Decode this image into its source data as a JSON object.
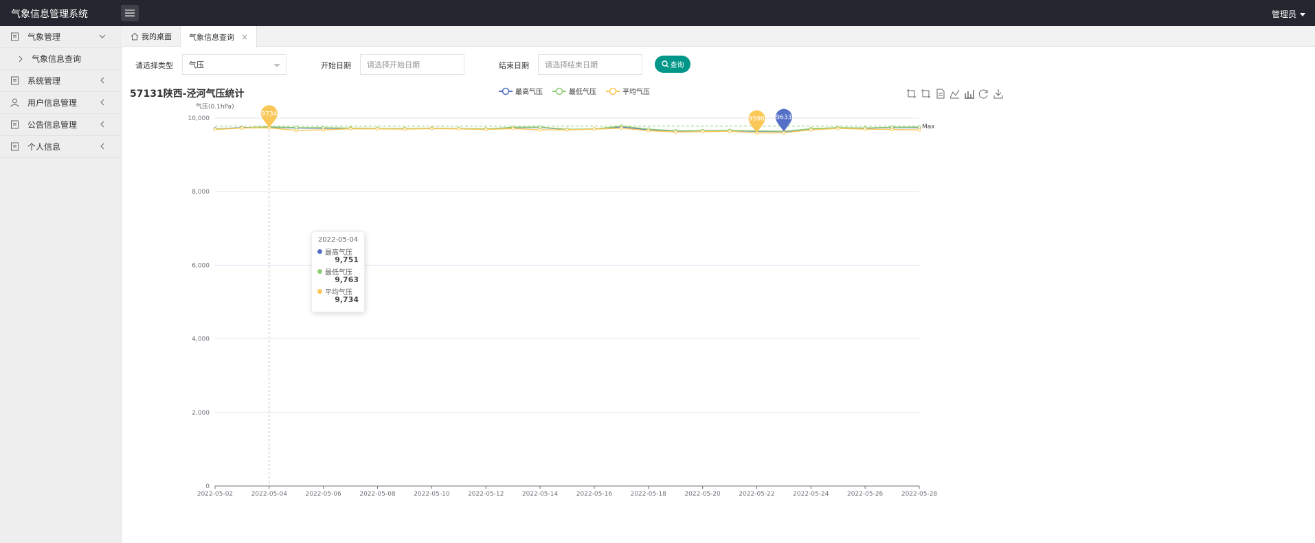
{
  "app": {
    "title": "气象信息管理系统",
    "user": "管理员"
  },
  "sidebar": {
    "items": [
      {
        "label": "气象管理",
        "icon": "doc-icon",
        "expanded": true
      },
      {
        "label": "系统管理",
        "icon": "doc-icon"
      },
      {
        "label": "用户信息管理",
        "icon": "user-icon"
      },
      {
        "label": "公告信息管理",
        "icon": "doc-icon"
      },
      {
        "label": "个人信息",
        "icon": "doc-icon"
      }
    ],
    "sub_items": [
      {
        "label": "气象信息查询"
      }
    ]
  },
  "tabs": {
    "home": "我的桌面",
    "active": "气象信息查询"
  },
  "filters": {
    "type_label": "请选择类型",
    "type_value": "气压",
    "start_label": "开始日期",
    "start_placeholder": "请选择开始日期",
    "end_label": "结束日期",
    "end_placeholder": "请选择结束日期",
    "query_label": "查询"
  },
  "colors": {
    "series_max": "#5470c6",
    "series_min": "#91cc75",
    "series_avg": "#fac858",
    "accent": "#009688"
  },
  "chart_data": {
    "type": "line",
    "title": "57131陕西-泾河气压统计",
    "ylabel": "气压(0.1hPa)",
    "ylim": [
      0,
      10000
    ],
    "yticks": [
      0,
      2000,
      4000,
      6000,
      8000,
      10000
    ],
    "ytick_labels": [
      "0",
      "2,000",
      "4,000",
      "6,000",
      "8,000",
      "10,000"
    ],
    "x": [
      "2022-05-02",
      "2022-05-03",
      "2022-05-04",
      "2022-05-05",
      "2022-05-06",
      "2022-05-07",
      "2022-05-08",
      "2022-05-09",
      "2022-05-10",
      "2022-05-11",
      "2022-05-12",
      "2022-05-13",
      "2022-05-14",
      "2022-05-15",
      "2022-05-16",
      "2022-05-17",
      "2022-05-18",
      "2022-05-19",
      "2022-05-20",
      "2022-05-21",
      "2022-05-22",
      "2022-05-23",
      "2022-05-24",
      "2022-05-25",
      "2022-05-26",
      "2022-05-27",
      "2022-05-28"
    ],
    "xtick_labels": [
      "2022-05-02",
      "2022-05-04",
      "2022-05-06",
      "2022-05-08",
      "2022-05-10",
      "2022-05-12",
      "2022-05-14",
      "2022-05-16",
      "2022-05-18",
      "2022-05-20",
      "2022-05-22",
      "2022-05-24",
      "2022-05-26",
      "2022-05-28"
    ],
    "legend_position": "top-center",
    "series": [
      {
        "name": "最高气压",
        "values": [
          9705,
          9740,
          9751,
          9730,
          9725,
          9722,
          9715,
          9710,
          9720,
          9712,
          9700,
          9740,
          9745,
          9690,
          9700,
          9762,
          9680,
          9650,
          9655,
          9660,
          9640,
          9633,
          9700,
          9735,
          9725,
          9740,
          9740
        ]
      },
      {
        "name": "最低气压",
        "values": [
          9700,
          9735,
          9763,
          9740,
          9738,
          9728,
          9718,
          9712,
          9725,
          9715,
          9705,
          9750,
          9755,
          9695,
          9705,
          9780,
          9700,
          9655,
          9660,
          9665,
          9650,
          9640,
          9710,
          9740,
          9730,
          9750,
          9755
        ]
      },
      {
        "name": "平均气压",
        "values": [
          9690,
          9730,
          9734,
          9665,
          9680,
          9710,
          9705,
          9700,
          9715,
          9705,
          9690,
          9715,
          9680,
          9680,
          9700,
          9725,
          9660,
          9620,
          9630,
          9640,
          9596,
          9600,
          9680,
          9720,
          9700,
          9690,
          9680
        ]
      }
    ],
    "markers": [
      {
        "series": "平均气压",
        "label": "9734",
        "x": "2022-05-04",
        "value": 9734
      },
      {
        "series": "平均气压",
        "label": "9596",
        "x": "2022-05-22",
        "value": 9596
      },
      {
        "series": "最高气压",
        "label": "9633",
        "x": "2022-05-23",
        "value": 9633
      }
    ],
    "markline": {
      "label": "Max",
      "value": 9780
    },
    "tooltip": {
      "date": "2022-05-04",
      "rows": [
        {
          "name": "最高气压",
          "value": "9,751"
        },
        {
          "name": "最低气压",
          "value": "9,763"
        },
        {
          "name": "平均气压",
          "value": "9,734"
        }
      ]
    }
  }
}
